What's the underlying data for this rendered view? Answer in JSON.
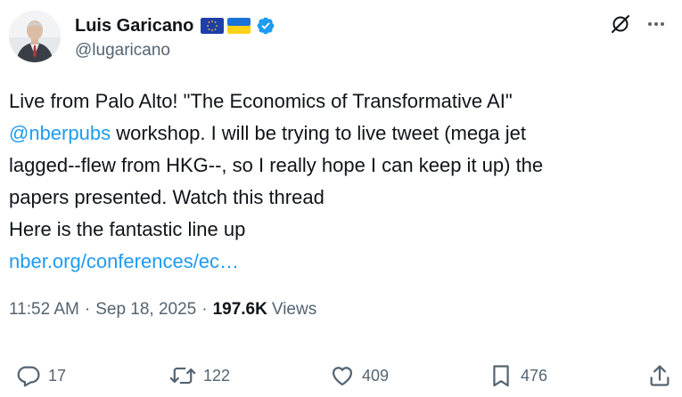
{
  "author": {
    "display_name": "Luis Garicano",
    "handle": "@lugaricano",
    "badges": [
      "eu-flag-icon",
      "ukraine-flag-icon",
      "verified-badge-icon"
    ]
  },
  "header_actions": [
    "grok-icon",
    "more-options-icon"
  ],
  "tweet": {
    "line1": "Live from Palo Alto! \"The Economics of Transformative AI\"",
    "mention": "@nberpubs",
    "line2_rest": " workshop. I will be trying to live tweet (mega jet",
    "line3": "lagged--flew from HKG--, so I really hope I can keep it up) the",
    "line4": "papers presented. Watch this thread",
    "line5": "Here is the fantastic line up",
    "link": "nber.org/conferences/ec…"
  },
  "meta": {
    "time": "11:52 AM",
    "separator": "·",
    "date": "Sep 18, 2025",
    "views_count": "197.6K",
    "views_label": "Views"
  },
  "actions": {
    "replies": "17",
    "reposts": "122",
    "likes": "409",
    "bookmarks": "476"
  },
  "colors": {
    "text": "#0f1419",
    "secondary": "#536471",
    "link": "#1d9bf0",
    "verified": "#1d9bf0"
  }
}
